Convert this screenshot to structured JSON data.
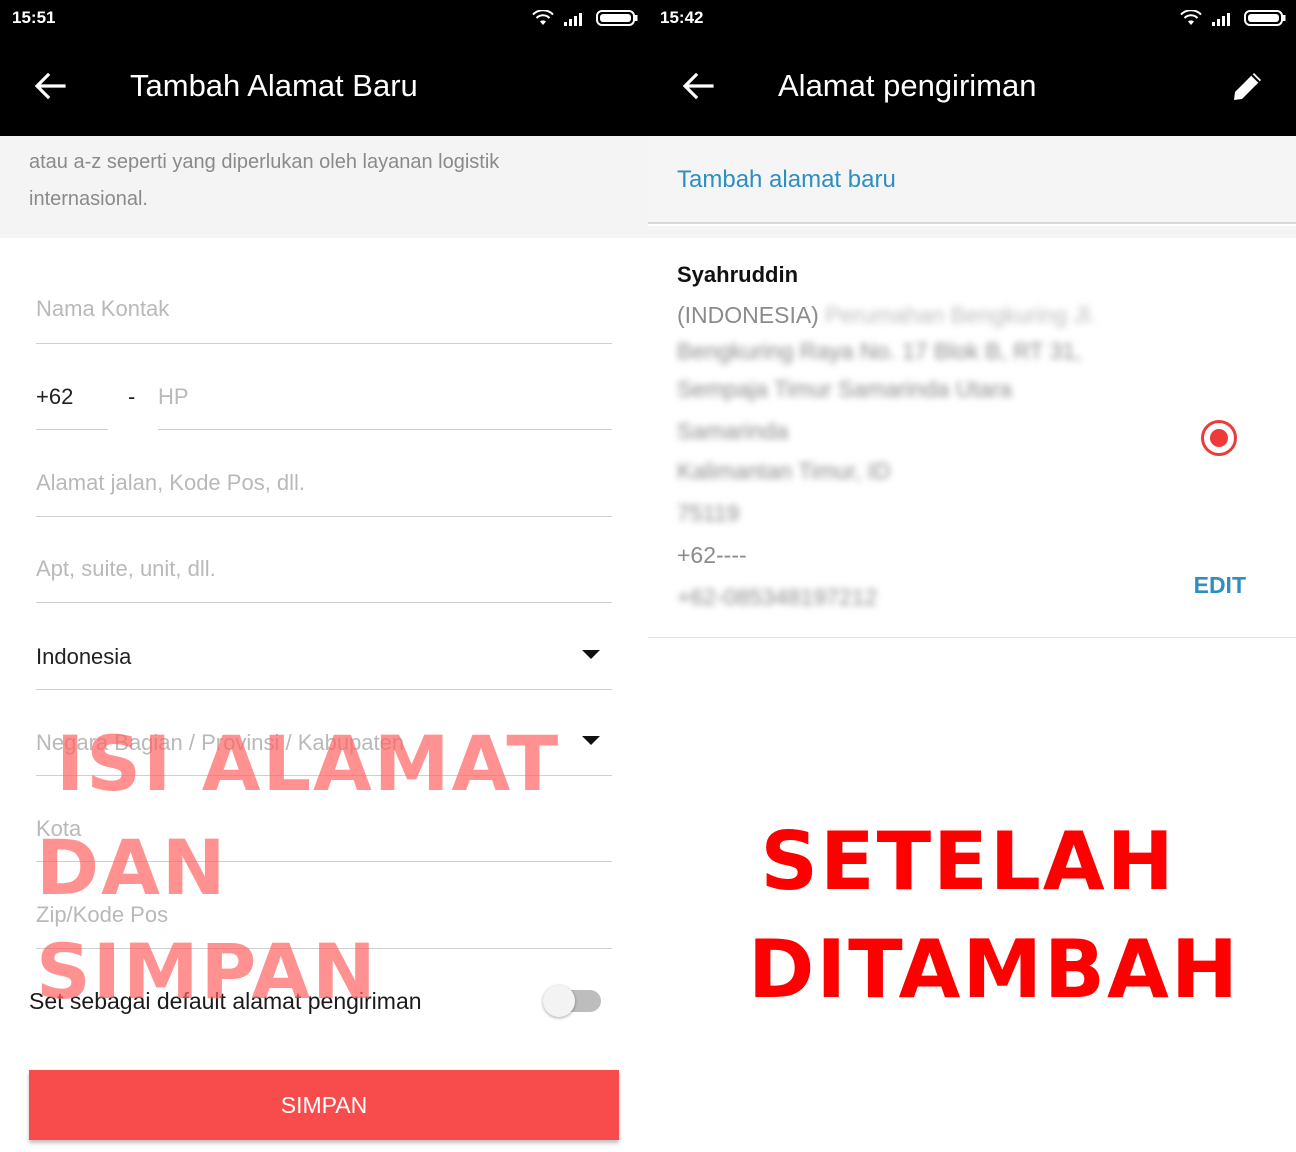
{
  "left": {
    "status_time": "15:51",
    "title": "Tambah Alamat Baru",
    "note": [
      "atau a-z seperti yang diperlukan oleh layanan logistik",
      "internasional."
    ],
    "fields": {
      "contact_name_placeholder": "Nama Kontak",
      "country_code": "+62",
      "phone_separator": "-",
      "phone_placeholder": "HP",
      "street_placeholder": "Alamat jalan, Kode Pos, dll.",
      "apt_placeholder": "Apt, suite, unit, dll.",
      "country_value": "Indonesia",
      "state_placeholder": "Negara Bagian / Provinsi / Kabupaten",
      "city_placeholder": "Kota",
      "zip_placeholder": "Zip/Kode Pos"
    },
    "default_toggle_label": "Set sebagai default alamat pengiriman",
    "default_toggle_on": false,
    "save_label": "SIMPAN",
    "overlay": [
      "ISI ALAMAT",
      "DAN SIMPAN"
    ]
  },
  "right": {
    "status_time": "15:42",
    "title": "Alamat pengiriman",
    "add_link": "Tambah alamat baru",
    "card": {
      "name": "Syahruddin",
      "country": "(INDONESIA)",
      "address_blurred": [
        "Perumahan Bengkuring Jl.",
        "Bengkuring Raya No. 17 Blok B, RT 31,",
        "Sempaja Timur Samarinda Utara",
        "Samarinda",
        "Kalimantan Timur, ID",
        "75119"
      ],
      "phone": "+62----",
      "phone_blurred": "+62-085348197212",
      "selected": true,
      "edit_label": "EDIT"
    },
    "overlay": [
      "SETELAH",
      "DITAMBAH"
    ]
  },
  "colors": {
    "appbar": "#000000",
    "save_button": "#f84b4b",
    "link": "#2d8fbf",
    "radio": "#ef3a3a",
    "overlay_right": "#ff0000",
    "overlay_left": "#ff6363"
  }
}
